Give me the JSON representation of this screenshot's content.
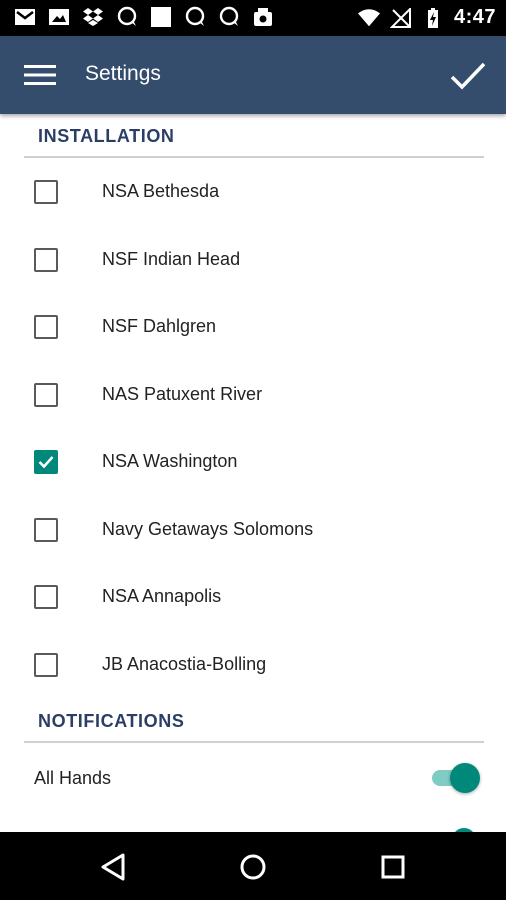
{
  "status_bar": {
    "time": "4:47",
    "notification_icons": [
      "gmail-icon",
      "image-icon",
      "dropbox-icon",
      "chat-bubble-icon",
      "blank-app-icon",
      "chat-bubble-icon",
      "chat-bubble-icon",
      "photo-upload-icon"
    ],
    "system_icons": [
      "wifi-icon",
      "no-signal-icon",
      "battery-charging-icon"
    ]
  },
  "app_bar": {
    "title": "Settings",
    "menu_icon": "hamburger-menu-icon",
    "done_icon": "checkmark-icon",
    "background": "#344d6c"
  },
  "installation": {
    "header": "INSTALLATION",
    "items": [
      {
        "label": "NSA Bethesda",
        "checked": false
      },
      {
        "label": "NSF Indian Head",
        "checked": false
      },
      {
        "label": "NSF Dahlgren",
        "checked": false
      },
      {
        "label": "NAS Patuxent River",
        "checked": false
      },
      {
        "label": "NSA Washington",
        "checked": true
      },
      {
        "label": "Navy Getaways Solomons",
        "checked": false
      },
      {
        "label": "NSA Annapolis",
        "checked": false
      },
      {
        "label": "JB Anacostia-Bolling",
        "checked": false
      }
    ]
  },
  "notifications": {
    "header": "NOTIFICATIONS",
    "items": [
      {
        "label": "All Hands",
        "enabled": true
      }
    ]
  },
  "nav_bar": {
    "icons": [
      "back-icon",
      "home-icon",
      "recents-icon"
    ]
  },
  "colors": {
    "accent": "#00897b",
    "header_text": "#2b3f66"
  }
}
